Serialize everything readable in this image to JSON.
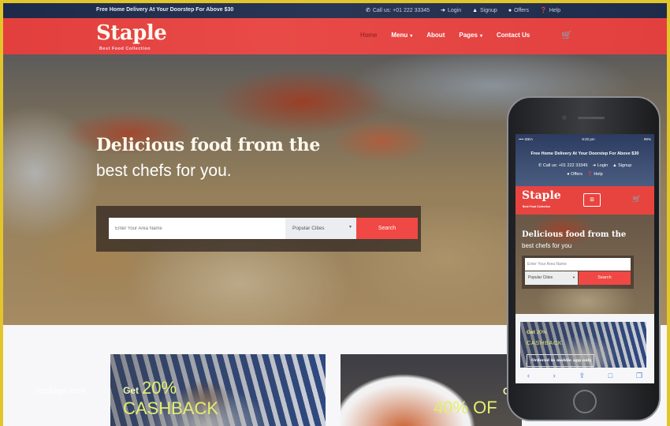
{
  "topbar": {
    "promo": "Free Home Delivery At Your Doorstep For Above $30",
    "links": [
      {
        "icon": "phone-icon",
        "glyph": "✆",
        "label": "Call us: +01 222 33345"
      },
      {
        "icon": "login-icon",
        "glyph": "➔",
        "label": "Login"
      },
      {
        "icon": "signup-icon",
        "glyph": "👤",
        "label": "Signup"
      },
      {
        "icon": "offers-icon",
        "glyph": "✚",
        "label": "Offers"
      },
      {
        "icon": "help-icon",
        "glyph": "?",
        "label": "Help"
      }
    ]
  },
  "brand": {
    "name": "Staple",
    "tagline": "Best Food Collection",
    "accent": "#e8443f",
    "topbar_color": "#1f2b4a"
  },
  "nav": {
    "items": [
      {
        "label": "Home",
        "active": true,
        "dropdown": false
      },
      {
        "label": "Menu",
        "active": false,
        "dropdown": true
      },
      {
        "label": "About",
        "active": false,
        "dropdown": false
      },
      {
        "label": "Pages",
        "active": false,
        "dropdown": true
      },
      {
        "label": "Contact Us",
        "active": false,
        "dropdown": false
      }
    ],
    "cart_icon": "cart-icon",
    "caret": "▾"
  },
  "hero": {
    "headline": "Delicious food from the",
    "subheadline": "best chefs for you.",
    "search": {
      "placeholder": "Enter Your Area Name",
      "select_value": "Popular Cities",
      "button": "Search"
    }
  },
  "offers": [
    {
      "prefix": "Get",
      "amount": "20%",
      "label": "CASHBACK"
    },
    {
      "prefix": "G",
      "amount": "40% OF",
      "label": ""
    }
  ],
  "watermark": "ncollage.com",
  "phone": {
    "status": {
      "carrier": "•••• IDEA",
      "time": "9:20 pm",
      "battery": "90%"
    },
    "promo": "Free Home Delivery At Your Doorstep For Above $30",
    "links_row1": [
      "Call us: +01 222 33345",
      "Login",
      "Signup"
    ],
    "links_row2": [
      "Offers",
      "Help"
    ],
    "brand": "Staple",
    "tagline": "Best Food Collection",
    "menu_icon": "≡",
    "headline": "Delicious food from the",
    "subheadline": "best chefs for you",
    "search_placeholder": "Enter Your Area Name",
    "select_value": "Popular Cities",
    "search_button": "Search",
    "offer": {
      "prefix": "Get",
      "amount": "20%",
      "label": "CASHBACK",
      "note": "Ordered in mobile app only"
    },
    "toolbar": [
      "‹",
      "›",
      "⇪",
      "📖",
      "❐"
    ]
  }
}
